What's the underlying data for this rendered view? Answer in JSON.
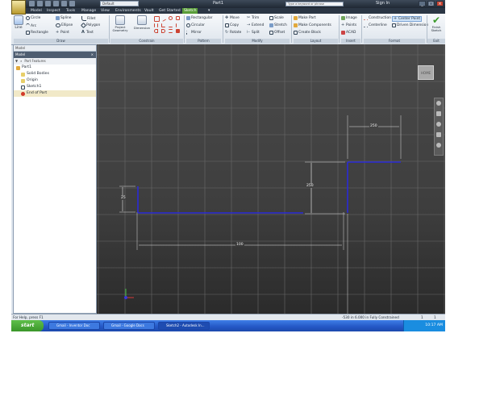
{
  "window": {
    "title": "Part1",
    "appearance": "Default",
    "help_search": "Type a keyword or phrase",
    "sign_in": "Sign In"
  },
  "tabs": [
    "Model",
    "Inspect",
    "Tools",
    "Manage",
    "View",
    "Environments",
    "Vault",
    "Get Started",
    "Sketch"
  ],
  "active_tab": "Sketch",
  "ribbon": {
    "draw": {
      "line": "Line",
      "circle": "Circle",
      "arc": "Arc",
      "rectangle": "Rectangle",
      "spline": "Spline",
      "ellipse": "Ellipse",
      "point": "Point",
      "fillet": "Fillet",
      "polygon": "Polygon",
      "text": "Text",
      "label": "Draw"
    },
    "geometry": {
      "project": "Project Geometry"
    },
    "constrain": {
      "dimension": "Dimension",
      "label": "Constrain"
    },
    "pattern": {
      "rectangular": "Rectangular",
      "circular": "Circular",
      "mirror": "Mirror",
      "label": "Pattern"
    },
    "modify": {
      "move": "Move",
      "copy": "Copy",
      "rotate": "Rotate",
      "trim": "Trim",
      "extend": "Extend",
      "split": "Split",
      "scale": "Scale",
      "stretch": "Stretch",
      "offset": "Offset",
      "label": "Modify"
    },
    "layout": {
      "make_part": "Make Part",
      "make_components": "Make Components",
      "create_block": "Create Block",
      "label": "Layout"
    },
    "insert": {
      "image": "Image",
      "points": "Points",
      "acad": "ACAD",
      "label": "Insert"
    },
    "format": {
      "construction": "Construction",
      "centerline": "Centerline",
      "center_point": "Center Point",
      "driven": "Driven Dimension",
      "label": "Format"
    },
    "exit": {
      "finish": "Finish Sketch",
      "label": "Exit"
    }
  },
  "browser": {
    "header": "Model",
    "toolbar_label": "Model",
    "filter_label": "Part Features",
    "tree": [
      {
        "label": "Part1",
        "icon": "part-icon"
      },
      {
        "label": "Solid Bodies",
        "icon": "folder-icon"
      },
      {
        "label": "Origin",
        "icon": "folder-icon"
      },
      {
        "label": "Sketch1",
        "icon": "sketch-icon"
      },
      {
        "label": "End of Part",
        "icon": "end-of-part-icon"
      }
    ]
  },
  "sketch": {
    "dimensions": {
      "left_height": "25",
      "bottom_length": "100",
      "step_height": "250",
      "top_length": "250"
    },
    "line_color": "#2b2bd6"
  },
  "status": {
    "left": "For Help, press F1",
    "coords": "-530 in  6.000 in  Fully Constrained",
    "count_a": "1",
    "count_b": "1"
  },
  "taskbar": {
    "start": "start",
    "items": [
      "Gmail - Inventor Doc",
      "Gmail - Google Docs",
      "Sketch2 - Autodesk In..."
    ],
    "clock": "10:17 AM"
  },
  "colors": {
    "active_tab": "#5a9e3a",
    "taskbar": "#2559c7",
    "start": "#3a962a",
    "canvas_top": "#4a4a4a",
    "canvas_bottom": "#2b2b2b"
  }
}
